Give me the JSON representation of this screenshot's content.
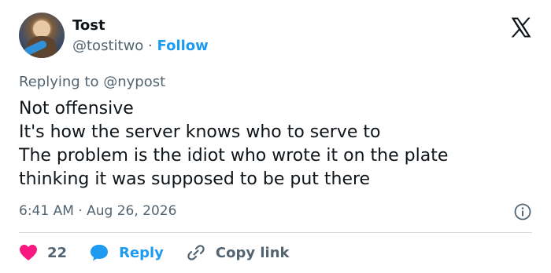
{
  "author": {
    "name": "Tost",
    "handle": "@tostitwo",
    "separator": "·",
    "follow_label": "Follow"
  },
  "reply_context": {
    "prefix": "Replying to",
    "mention": "@nypost"
  },
  "tweet": {
    "lines": [
      "Not offensive",
      "It's how the server knows who to serve to",
      "The problem is the idiot who wrote it on the plate",
      "thinking it was supposed to be put there"
    ],
    "time": "6:41 AM",
    "separator": "·",
    "date": "Aug 26, 2026"
  },
  "actions": {
    "like_count": "22",
    "reply_label": "Reply",
    "copy_link_label": "Copy link"
  },
  "icons": {
    "brand": "x-logo-icon",
    "info": "info-icon",
    "like": "heart-icon",
    "reply": "speech-bubble-icon",
    "copy_link": "link-icon"
  },
  "colors": {
    "accent": "#1d9bf0",
    "like": "#f91880",
    "secondary_text": "#536471",
    "text": "#0f1419"
  }
}
